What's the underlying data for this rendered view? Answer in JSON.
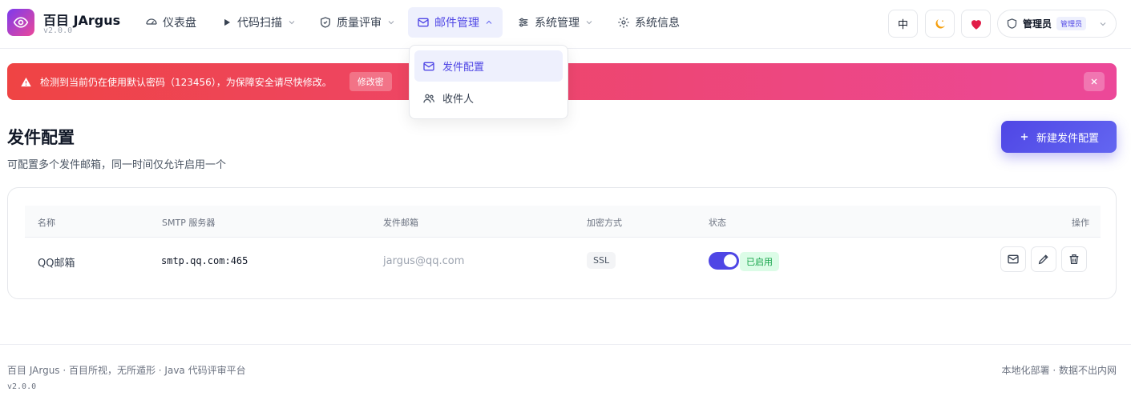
{
  "app": {
    "name": "百目 JArgus",
    "version": "v2.0.0"
  },
  "nav": {
    "items": [
      {
        "label": "仪表盘",
        "icon": "dashboard-icon"
      },
      {
        "label": "代码扫描",
        "icon": "play-icon"
      },
      {
        "label": "质量评审",
        "icon": "shield-icon"
      },
      {
        "label": "邮件管理",
        "icon": "mail-icon",
        "active": true
      },
      {
        "label": "系统管理",
        "icon": "sliders-icon"
      },
      {
        "label": "系统信息",
        "icon": "gear-icon"
      }
    ]
  },
  "header": {
    "lang_label": "中",
    "theme_icon": "moon-icon",
    "favorite_icon": "heart-icon",
    "user_name": "管理员",
    "user_role": "管理员"
  },
  "dropdown": {
    "items": [
      {
        "label": "发件配置",
        "icon": "mail-icon",
        "active": true
      },
      {
        "label": "收件人",
        "icon": "users-icon"
      }
    ]
  },
  "alert": {
    "text": "检测到当前仍在使用默认密码（123456），为保障安全请尽快修改。",
    "action_label": "修改密",
    "color_start": "#ef4444",
    "color_end": "#ec4899"
  },
  "page": {
    "title": "发件配置",
    "subtitle": "可配置多个发件邮箱，同一时间仅允许启用一个",
    "new_button_label": "新建发件配置"
  },
  "table": {
    "columns": [
      "名称",
      "SMTP 服务器",
      "发件邮箱",
      "加密方式",
      "状态",
      "操作"
    ],
    "rows": [
      {
        "name": "QQ邮箱",
        "smtp": "smtp.qq.com:465",
        "email": "jargus@qq.com",
        "encryption": "SSL",
        "enabled": true,
        "status_label": "已启用"
      }
    ]
  },
  "footer": {
    "left_text": "百目 JArgus · 百目所视，无所遁形 · Java 代码评审平台",
    "version": "v2.0.0",
    "right_text": "本地化部署 · 数据不出内网"
  },
  "colors": {
    "accent": "#4f46e5",
    "accent_bg": "#eef0fd",
    "success": "#16a34a"
  }
}
